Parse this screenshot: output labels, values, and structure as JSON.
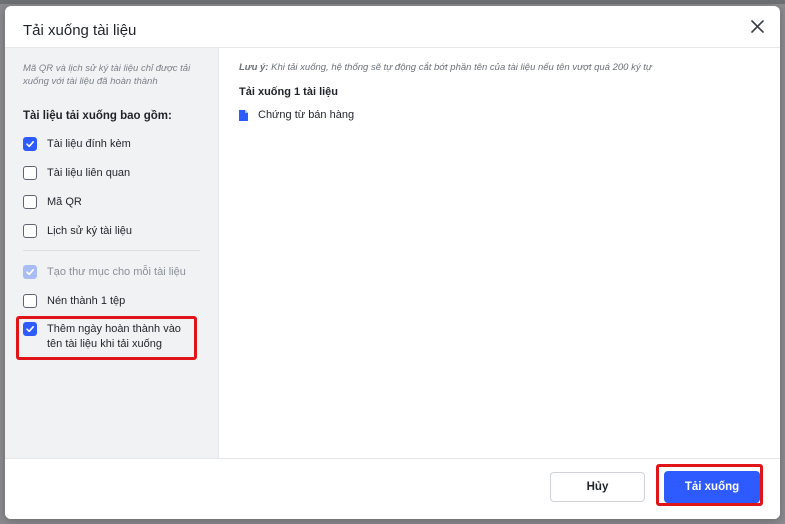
{
  "dialog": {
    "title": "Tải xuống tài liệu",
    "close_icon": "close-icon"
  },
  "sidebar": {
    "note": "Mã QR và lịch sử ký tài liệu chỉ được tải xuống với tài liệu đã hoàn thành",
    "section_title": "Tài liệu tải xuống bao gồm:",
    "options": [
      {
        "label": "Tài liệu đính kèm",
        "checked": true
      },
      {
        "label": "Tài liệu liên quan",
        "checked": false
      },
      {
        "label": "Mã QR",
        "checked": false
      },
      {
        "label": "Lịch sử ký tài liệu",
        "checked": false
      }
    ],
    "extra_options": [
      {
        "label": "Tạo thư mục cho mỗi tài liệu",
        "checked": true,
        "disabled": true
      },
      {
        "label": "Nén thành 1 tệp",
        "checked": false
      },
      {
        "label_line1": "Thêm ngày hoàn thành vào",
        "label_line2": "tên tài liệu khi tải xuống",
        "checked": true
      }
    ]
  },
  "content": {
    "note_prefix": "Lưu ý:",
    "note_text": " Khi tải xuống, hệ thống sẽ tự động cắt bớt phần tên của tài liệu nếu tên vượt quá 200 ký tự",
    "count_title": "Tải xuống 1 tài liệu",
    "files": [
      {
        "name": "Chứng từ bán hàng",
        "icon": "document-icon"
      }
    ]
  },
  "footer": {
    "cancel_label": "Hủy",
    "download_label": "Tải xuống"
  },
  "colors": {
    "accent": "#2e5bff",
    "highlight": "#e0151a"
  }
}
